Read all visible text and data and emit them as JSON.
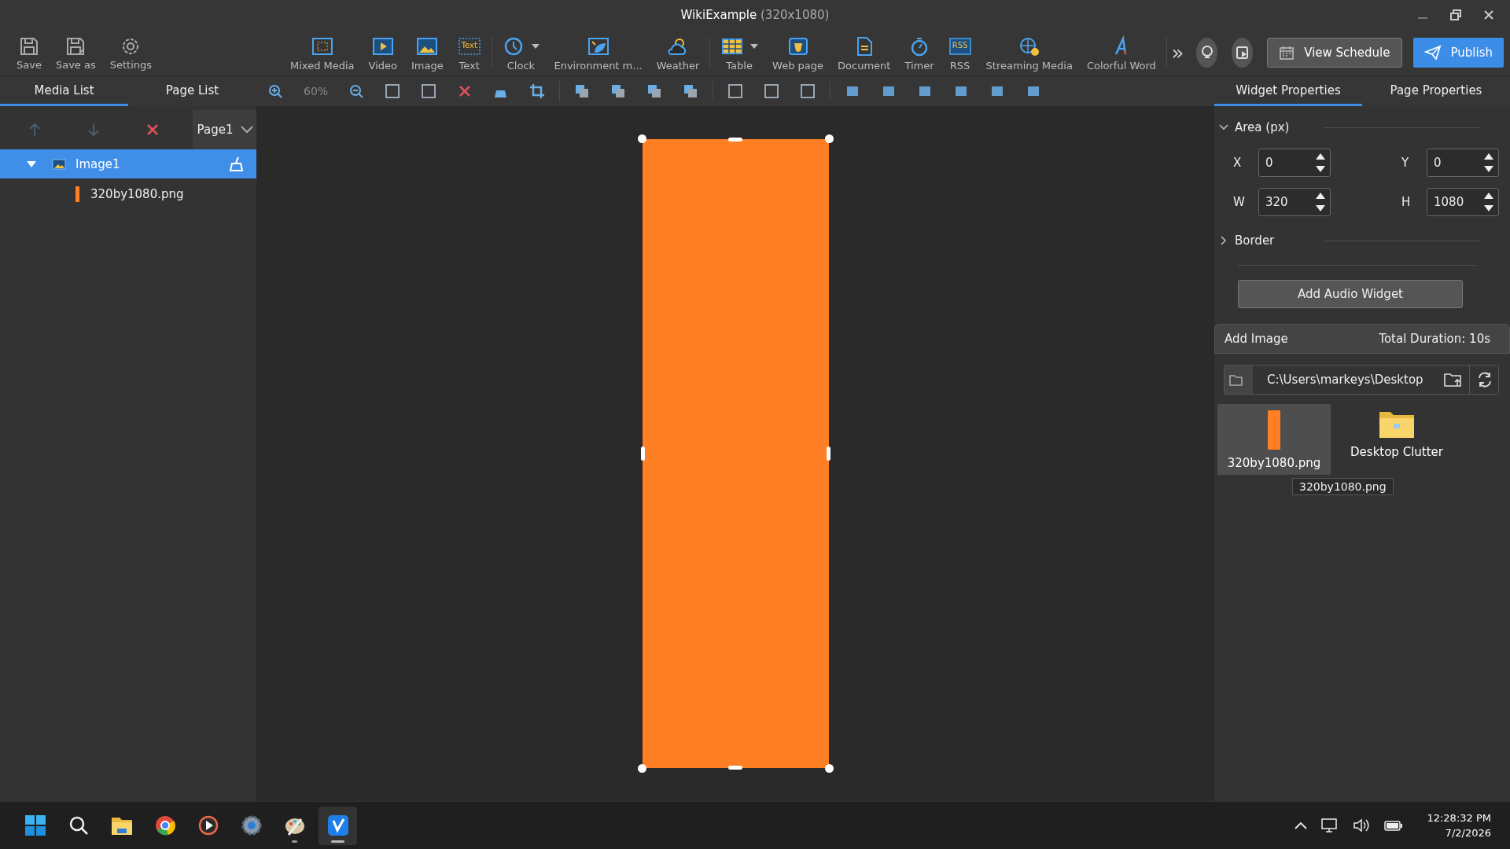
{
  "window": {
    "title": "WikiExample",
    "title_suffix": "(320x1080)"
  },
  "toolbar": {
    "file_items": [
      {
        "kind": "save",
        "label": "Save"
      },
      {
        "kind": "saveas",
        "label": "Save as"
      },
      {
        "kind": "settings",
        "label": "Settings"
      }
    ],
    "widget_groups": [
      [
        {
          "kind": "mixed",
          "label": "Mixed Media"
        },
        {
          "kind": "video",
          "label": "Video"
        },
        {
          "kind": "image",
          "label": "Image"
        },
        {
          "kind": "text",
          "label": "Text",
          "icon_text": "Text"
        }
      ],
      [
        {
          "kind": "clock",
          "label": "Clock",
          "dropdown": true
        },
        {
          "kind": "env",
          "label": "Environment m..."
        },
        {
          "kind": "weather",
          "label": "Weather"
        }
      ],
      [
        {
          "kind": "table",
          "label": "Table",
          "dropdown": true
        },
        {
          "kind": "web",
          "label": "Web page"
        },
        {
          "kind": "document",
          "label": "Document"
        },
        {
          "kind": "timer",
          "label": "Timer"
        },
        {
          "kind": "rss",
          "label": "RSS",
          "icon_text": "RSS"
        },
        {
          "kind": "streaming",
          "label": "Streaming Media"
        },
        {
          "kind": "colorful",
          "label": "Colorful Word"
        }
      ]
    ],
    "more": "»",
    "view_schedule": "View Schedule",
    "publish": "Publish"
  },
  "left_tabs": [
    {
      "label": "Media List",
      "selected": true
    },
    {
      "label": "Page List",
      "selected": false
    }
  ],
  "page_select": "Page1",
  "media_tree": [
    {
      "label": "Image1",
      "expanded": true,
      "selected": true,
      "children": [
        {
          "label": "320by1080.png",
          "color": "#ff7f24"
        }
      ]
    }
  ],
  "zoom_level": "60%",
  "canvas": {
    "selected": true
  },
  "right_tabs": [
    {
      "label": "Widget Properties",
      "selected": true
    },
    {
      "label": "Page Properties",
      "selected": false
    }
  ],
  "sections": [
    {
      "title": "Area (px)",
      "expanded": true,
      "fields": [
        {
          "label": "X",
          "value": "0"
        },
        {
          "label": "Y",
          "value": "0"
        },
        {
          "label": "W",
          "value": "320"
        },
        {
          "label": "H",
          "value": "1080"
        }
      ]
    },
    {
      "title": "Border",
      "expanded": false
    }
  ],
  "add_audio": "Add Audio Widget",
  "add_image": {
    "title": "Add Image",
    "duration": "Total Duration: 10s",
    "path": "C:\\Users\\markeys\\Desktop"
  },
  "files": [
    {
      "kind": "image",
      "name": "320by1080.png",
      "selected": true
    },
    {
      "kind": "folder",
      "name": "Desktop Clutter",
      "selected": false
    }
  ],
  "tooltip": "320by1080.png",
  "taskbar": {
    "apps": [
      {
        "kind": "start",
        "running": false,
        "active": false
      },
      {
        "kind": "search",
        "running": false,
        "active": false
      },
      {
        "kind": "explorer",
        "running": false,
        "active": false
      },
      {
        "kind": "chrome",
        "running": false,
        "active": false
      },
      {
        "kind": "player",
        "running": false,
        "active": false
      },
      {
        "kind": "gear",
        "running": false,
        "active": false
      },
      {
        "kind": "paint",
        "running": true,
        "active": false
      },
      {
        "kind": "app",
        "running": true,
        "active": true
      }
    ],
    "time": "12:28:32 PM",
    "date": "7/2/2026"
  }
}
